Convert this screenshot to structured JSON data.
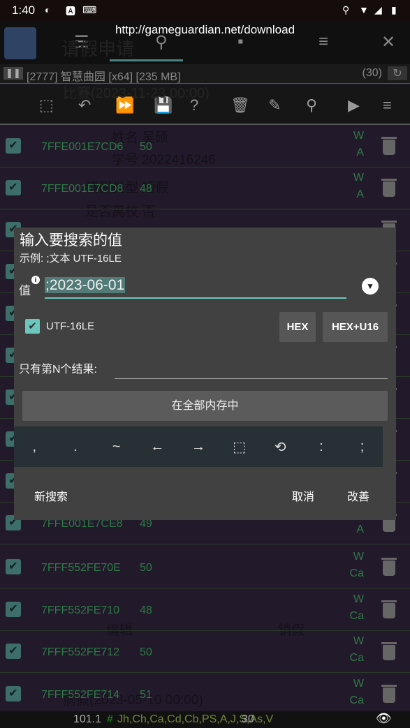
{
  "status_bar": {
    "time": "1:40"
  },
  "header": {
    "url": "http://gameguardian.net/download"
  },
  "process": {
    "info": "[2777] 智慧曲园 [x64] [235 MB]",
    "count": "(30)"
  },
  "background_app": {
    "title": "请假申请",
    "entry1": "比赛(2023-11-23 00:00)",
    "name_label": "姓名",
    "name_value": "吴硕",
    "id_label": "学号",
    "id_value": "2022416246",
    "type_label": "请假类型",
    "type_value": "短假",
    "leave_label": "是否离校",
    "leave_value": "否",
    "edit": "编辑",
    "cancel_leave": "销假",
    "entry2": "病假(2023-05-10 00:00)"
  },
  "rows": [
    {
      "address": "7FFE001E7CD6",
      "value": "50",
      "flags": [
        "W",
        "A"
      ]
    },
    {
      "address": "7FFE001E7CD8",
      "value": "48",
      "flags": [
        "W",
        "A"
      ]
    },
    {
      "address": "7FFE001E7CE8",
      "value": "49",
      "flags": [
        "W",
        "A"
      ]
    },
    {
      "address": "7FFF552FE70E",
      "value": "50",
      "flags": [
        "W",
        "Ca"
      ]
    },
    {
      "address": "7FFF552FE710",
      "value": "48",
      "flags": [
        "W",
        "Ca"
      ]
    },
    {
      "address": "7FFF552FE712",
      "value": "50",
      "flags": [
        "W",
        "Ca"
      ]
    },
    {
      "address": "7FFF552FE714",
      "value": "51",
      "flags": [
        "W",
        "Ca"
      ]
    }
  ],
  "dialog": {
    "title": "输入要搜索的值",
    "example": "示例: ;文本 UTF-16LE",
    "value_label": "值",
    "value": ";2023-06-01",
    "utf16_label": "UTF-16LE",
    "utf16_checked": true,
    "hex": "HEX",
    "hex_u16": "HEX+U16",
    "nth_label": "只有第N个结果:",
    "memory": "在全部内存中",
    "keys": [
      ",",
      ".",
      "~",
      "←",
      "→"
    ],
    "keys2": [
      ":",
      ";"
    ],
    "new_search": "新搜索",
    "cancel": "取消",
    "refine": "改善"
  },
  "footer": {
    "version": "101.1",
    "hash": "#",
    "regions": "Jh,Ch,Ca,Cd,Cb,PS,A,J,S,As,V",
    "count": "30"
  },
  "colors": {
    "accent": "#6cc6bc",
    "value_green": "#2d7a46",
    "dialog_bg": "#414141"
  }
}
